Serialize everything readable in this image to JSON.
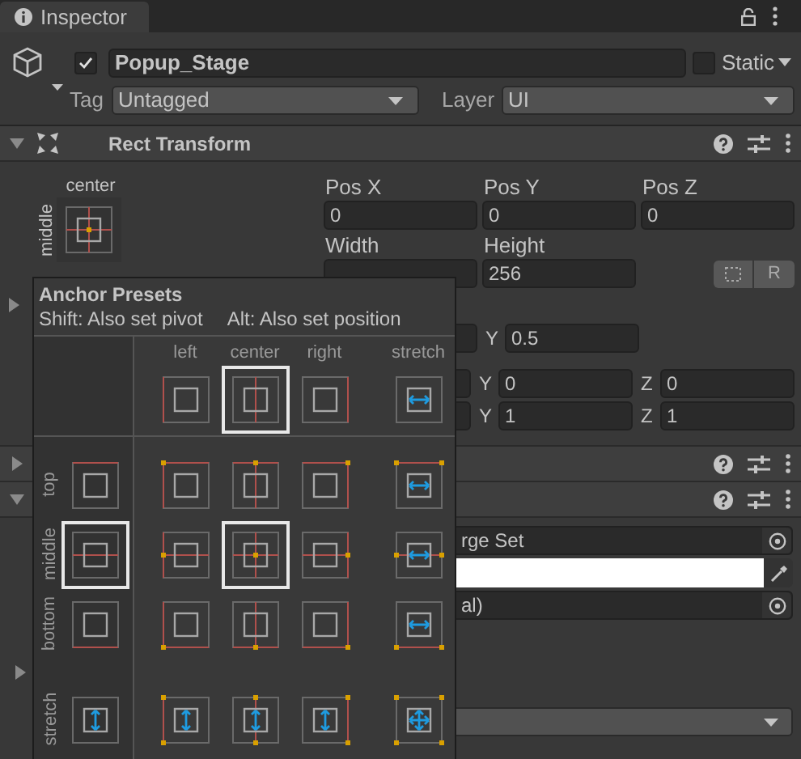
{
  "tab": {
    "title": "Inspector"
  },
  "game_object": {
    "active": true,
    "name": "Popup_Stage",
    "static_label": "Static",
    "static": false,
    "tag_label": "Tag",
    "tag": "Untagged",
    "layer_label": "Layer",
    "layer": "UI"
  },
  "rect_transform": {
    "title": "Rect Transform",
    "expanded": true,
    "preview": {
      "column_label": "center",
      "row_label": "middle"
    },
    "position": [
      {
        "label": "Pos X",
        "value": "0"
      },
      {
        "label": "Pos Y",
        "value": "0"
      },
      {
        "label": "Pos Z",
        "value": "0"
      }
    ],
    "size": [
      {
        "label": "Width"
      },
      {
        "label": "Height",
        "value": "256"
      }
    ],
    "raw_edit_label": "R",
    "anchors_expanded": false,
    "pivot": {
      "label": "Y",
      "value": "0.5"
    },
    "rotation": [
      {
        "label": "Y",
        "value": "0"
      },
      {
        "label": "Z",
        "value": "0"
      }
    ],
    "scale": [
      {
        "label": "Y",
        "value": "1"
      },
      {
        "label": "Z",
        "value": "1"
      }
    ]
  },
  "components": [
    {
      "expanded": false
    },
    {
      "expanded": true,
      "fields": [
        {
          "kind": "object",
          "value": "rge Set"
        },
        {
          "kind": "color",
          "color": "#ffffff"
        },
        {
          "kind": "object",
          "value": "al)"
        }
      ],
      "foldout_expanded": false
    }
  ],
  "anchor_presets": {
    "title": "Anchor Presets",
    "hint_shift": "Shift: Also set pivot",
    "hint_alt": "Alt: Also set position",
    "columns": [
      {
        "label": "left",
        "selected": false
      },
      {
        "label": "center",
        "selected": true
      },
      {
        "label": "right",
        "selected": false
      },
      {
        "label": "stretch",
        "selected": false
      }
    ],
    "rows": [
      {
        "label": "top",
        "selected": false
      },
      {
        "label": "middle",
        "selected": true
      },
      {
        "label": "bottom",
        "selected": false
      },
      {
        "label": "stretch",
        "selected": false
      }
    ]
  }
}
